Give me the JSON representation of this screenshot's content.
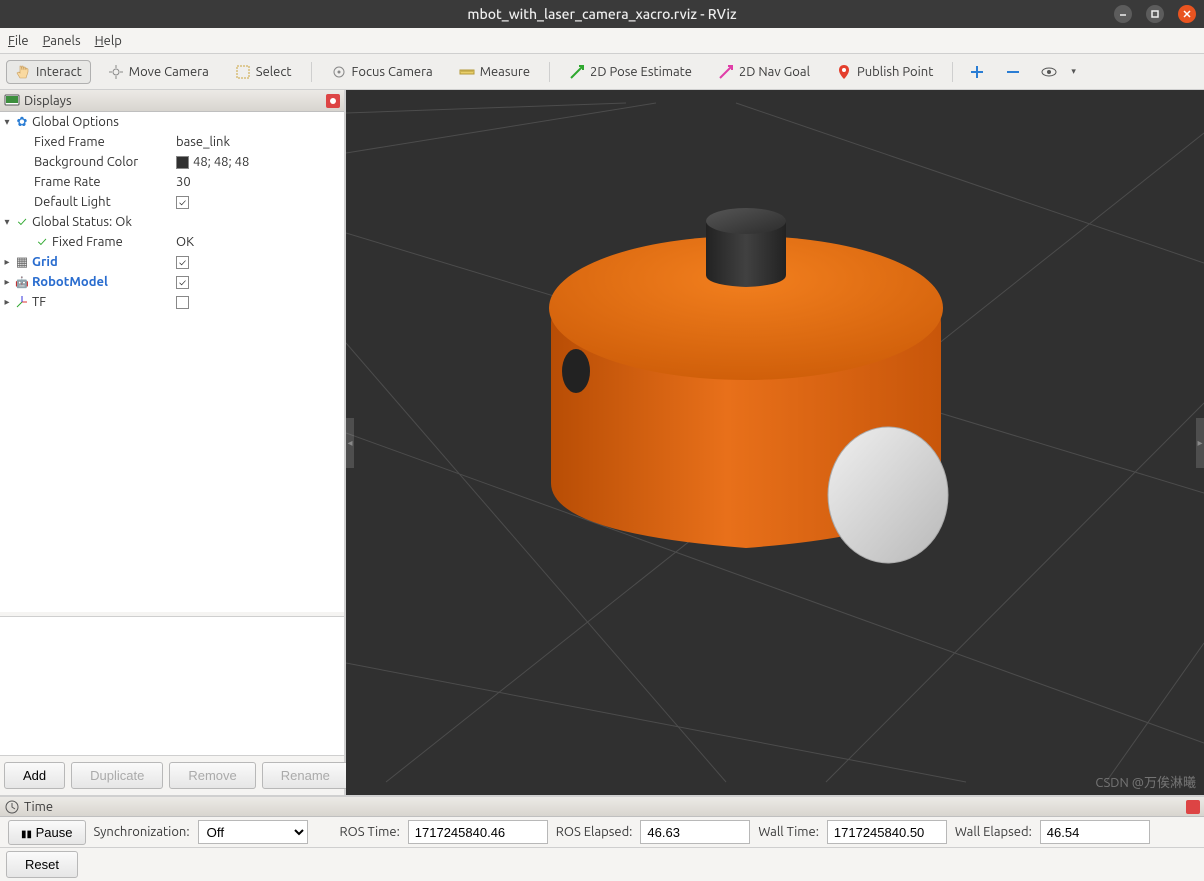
{
  "window": {
    "title": "mbot_with_laser_camera_xacro.rviz - RViz"
  },
  "menubar": {
    "file": "File",
    "panels": "Panels",
    "help": "Help"
  },
  "toolbar": {
    "interact": "Interact",
    "move_camera": "Move Camera",
    "select": "Select",
    "focus_camera": "Focus Camera",
    "measure": "Measure",
    "pose_estimate": "2D Pose Estimate",
    "nav_goal": "2D Nav Goal",
    "publish_point": "Publish Point"
  },
  "displays": {
    "title": "Displays",
    "global_options": {
      "label": "Global Options",
      "fixed_frame_label": "Fixed Frame",
      "fixed_frame_value": "base_link",
      "bg_label": "Background Color",
      "bg_value": "48; 48; 48",
      "frame_rate_label": "Frame Rate",
      "frame_rate_value": "30",
      "default_light_label": "Default Light"
    },
    "global_status": {
      "label": "Global Status: Ok",
      "fixed_frame_label": "Fixed Frame",
      "fixed_frame_value": "OK"
    },
    "grid": "Grid",
    "robot_model": "RobotModel",
    "tf": "TF"
  },
  "buttons": {
    "add": "Add",
    "duplicate": "Duplicate",
    "remove": "Remove",
    "rename": "Rename",
    "reset": "Reset",
    "pause": "Pause"
  },
  "time": {
    "title": "Time",
    "sync_label": "Synchronization:",
    "sync_value": "Off",
    "ros_time_label": "ROS Time:",
    "ros_time_value": "1717245840.46",
    "ros_elapsed_label": "ROS Elapsed:",
    "ros_elapsed_value": "46.63",
    "wall_time_label": "Wall Time:",
    "wall_time_value": "1717245840.50",
    "wall_elapsed_label": "Wall Elapsed:",
    "wall_elapsed_value": "46.54"
  },
  "watermark": "CSDN @万俟淋曦"
}
